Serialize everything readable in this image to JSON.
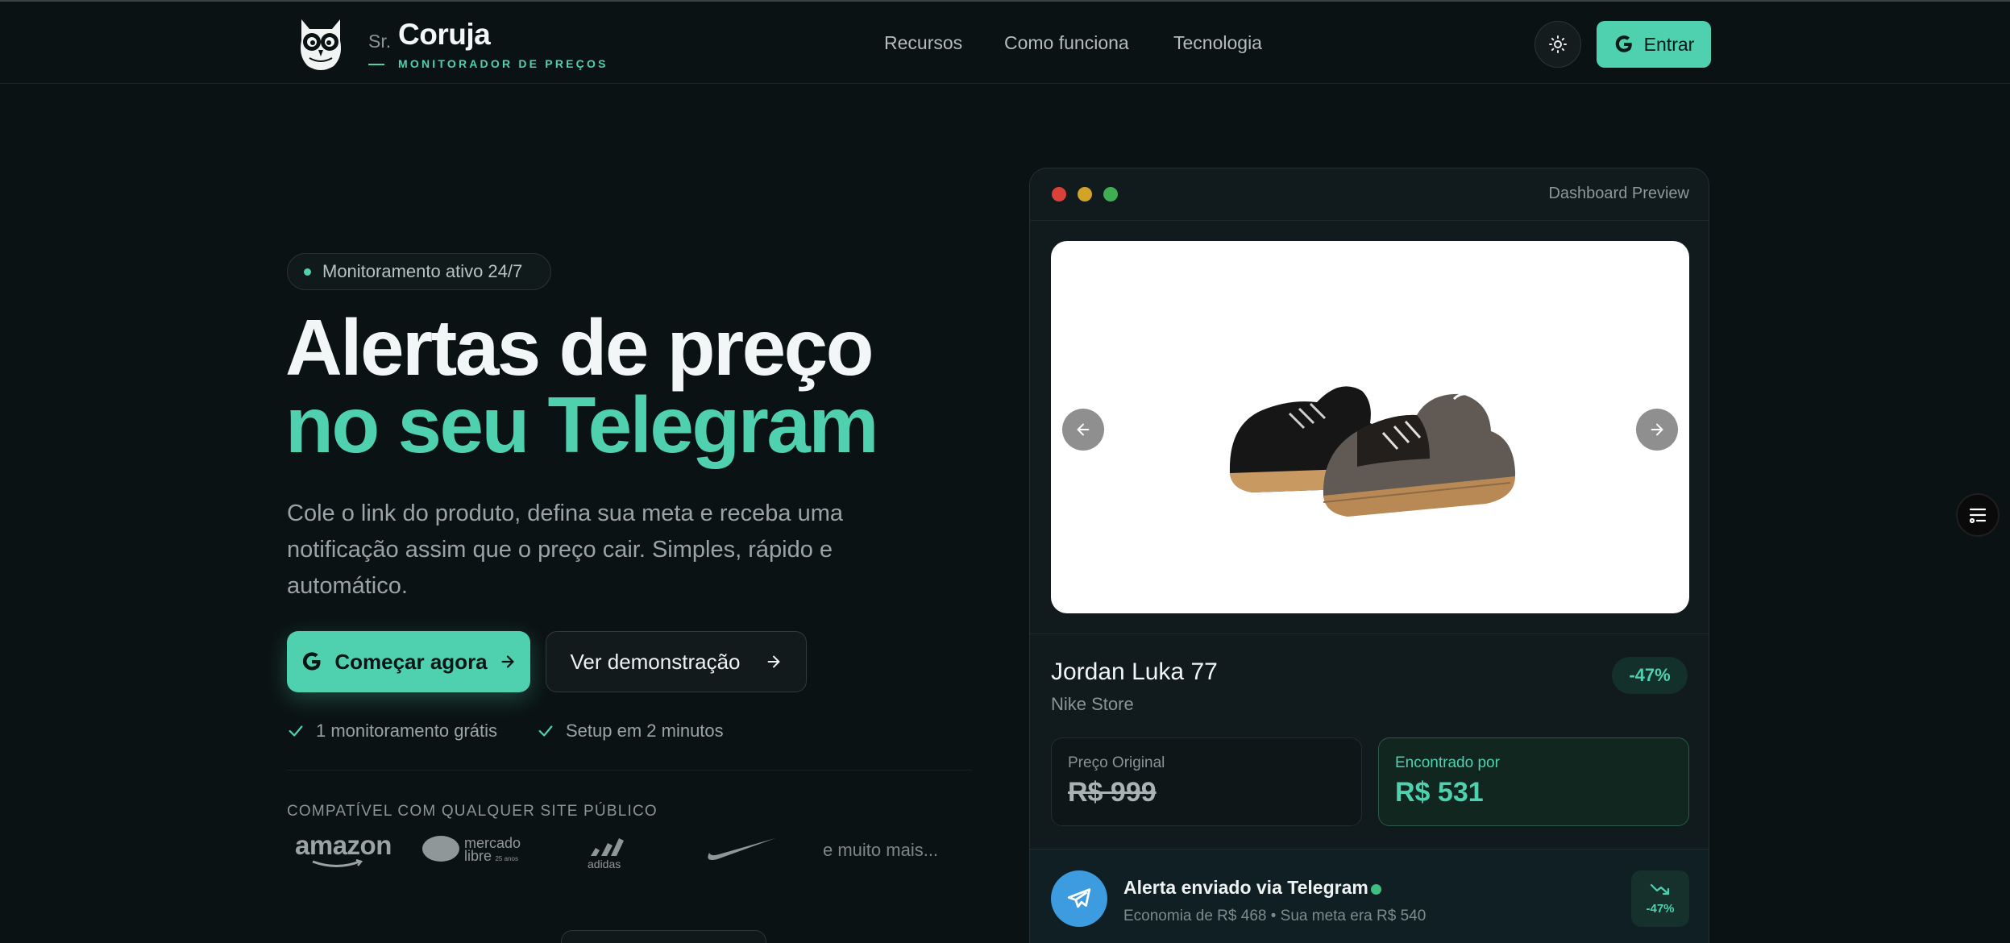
{
  "brand": {
    "prefix": "Sr.",
    "name": "Coruja",
    "tagline": "MONITORADOR DE PREÇOS"
  },
  "nav": {
    "links": [
      "Recursos",
      "Como funciona",
      "Tecnologia"
    ],
    "login_label": "Entrar"
  },
  "hero": {
    "status_pill": "Monitoramento ativo 24/7",
    "title_line1": "Alertas de preço",
    "title_line2": "no seu Telegram",
    "lead": "Cole o link do produto, defina sua meta e receba uma notificação assim que o preço cair. Simples, rápido e automático.",
    "cta_primary": "Começar agora",
    "cta_secondary": "Ver demonstração",
    "checks": [
      "1 monitoramento grátis",
      "Setup em 2 minutos"
    ],
    "compat_title": "COMPATÍVEL COM QUALQUER SITE PÚBLICO",
    "stores": [
      "amazon",
      "mercado",
      "libre",
      "25 anos",
      "adidas"
    ],
    "more_label": "e muito mais..."
  },
  "preview": {
    "window_title": "Dashboard Preview",
    "product_name": "Jordan Luka 77",
    "store": "Nike Store",
    "discount_badge": "-47%",
    "original_label": "Preço Original",
    "original_price": "R$ 999",
    "found_label": "Encontrado por",
    "found_price": "R$ 531",
    "alert_title": "Alerta enviado via Telegram",
    "alert_sub": "Economia de R$ 468 • Sua meta era R$ 540",
    "trend_value": "-47%"
  },
  "colors": {
    "accent": "#4fd1b0",
    "background": "#0b1213",
    "card": "#111a1c",
    "telegram": "#3d9be0"
  },
  "icons": [
    "owl-logo-icon",
    "sun-icon",
    "google-icon",
    "arrow-right-icon",
    "check-icon",
    "chevron-left-icon",
    "chevron-right-icon",
    "telegram-icon",
    "trending-down-icon",
    "list-filter-icon",
    "nike-swoosh-icon"
  ]
}
